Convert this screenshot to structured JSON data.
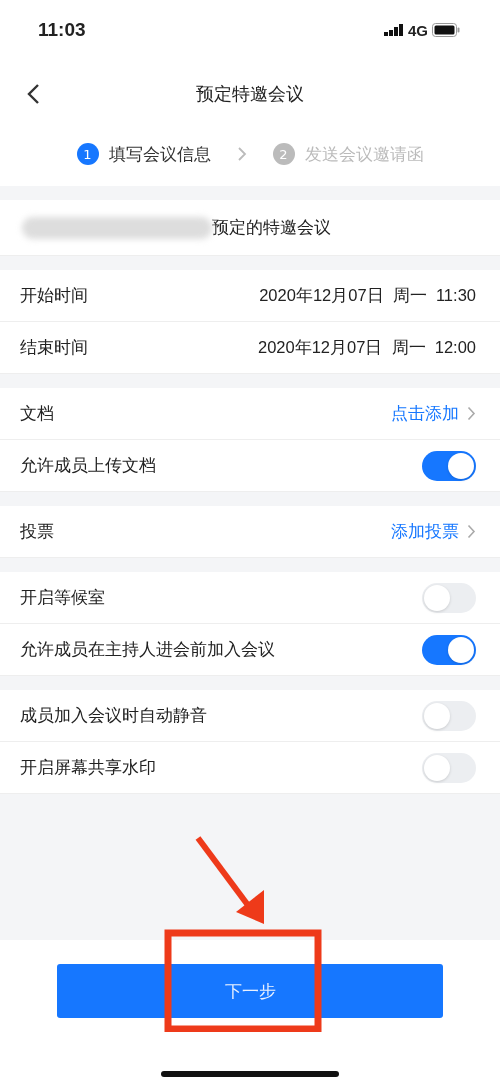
{
  "status_bar": {
    "time": "11:03",
    "network": "4G"
  },
  "nav": {
    "title": "预定特邀会议"
  },
  "steps": [
    {
      "number": "1",
      "label": "填写会议信息",
      "selected": true
    },
    {
      "number": "2",
      "label": "发送会议邀请函",
      "selected": false
    }
  ],
  "subject": {
    "text": "预定的特邀会议"
  },
  "groups": [
    {
      "rows": [
        {
          "kind": "datetime",
          "label": "开始时间",
          "date": "2020年12月07日",
          "weekday": "周一",
          "time": "11:30"
        },
        {
          "kind": "datetime",
          "label": "结束时间",
          "date": "2020年12月07日",
          "weekday": "周一",
          "time": "12:00"
        }
      ]
    },
    {
      "rows": [
        {
          "kind": "link",
          "label": "文档",
          "action": "点击添加"
        },
        {
          "kind": "toggle",
          "label": "允许成员上传文档",
          "on": true
        }
      ]
    },
    {
      "rows": [
        {
          "kind": "link",
          "label": "投票",
          "action": "添加投票"
        }
      ]
    },
    {
      "rows": [
        {
          "kind": "toggle",
          "label": "开启等候室",
          "on": false
        },
        {
          "kind": "toggle",
          "label": "允许成员在主持人进会前加入会议",
          "on": true
        }
      ]
    },
    {
      "rows": [
        {
          "kind": "toggle",
          "label": "成员加入会议时自动静音",
          "on": false
        },
        {
          "kind": "toggle",
          "label": "开启屏幕共享水印",
          "on": false
        }
      ]
    }
  ],
  "next_button": {
    "label": "下一步"
  }
}
